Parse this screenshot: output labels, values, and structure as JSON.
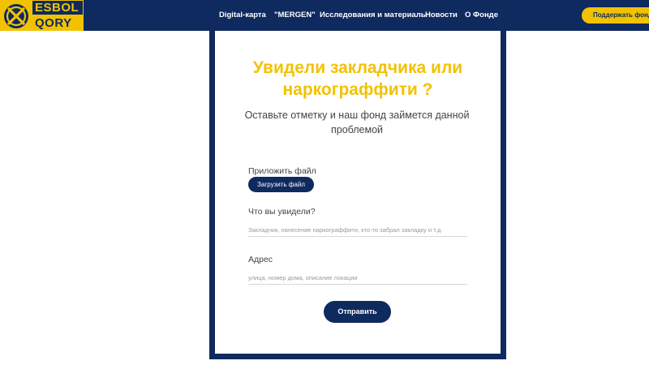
{
  "header": {
    "logo": {
      "line1": "ESBOL",
      "line2": "QORY"
    },
    "nav": [
      {
        "label": "Digital-карта"
      },
      {
        "label": "\"MERGEN\""
      },
      {
        "label": "Исследования и материалы"
      },
      {
        "label": "Новости"
      },
      {
        "label": "О Фонде"
      }
    ],
    "support_label": "Поддержать фонд"
  },
  "form": {
    "title": "Увидели закладчика или наркограффити ?",
    "subtitle": "Оставьте отметку и наш фонд займется данной проблемой",
    "attach_label": "Приложить файл",
    "upload_label": "Загрузить файл",
    "what_label": "Что вы увидели?",
    "what_placeholder": "Закладчик, нанесение наркограффити, кто-то забрал закладку и т.д.",
    "address_label": "Адрес",
    "address_placeholder": "улица, номер дома, описание локации",
    "submit_label": "Отправить"
  },
  "colors": {
    "navy": "#0f2a5e",
    "yellow": "#f2c200"
  }
}
